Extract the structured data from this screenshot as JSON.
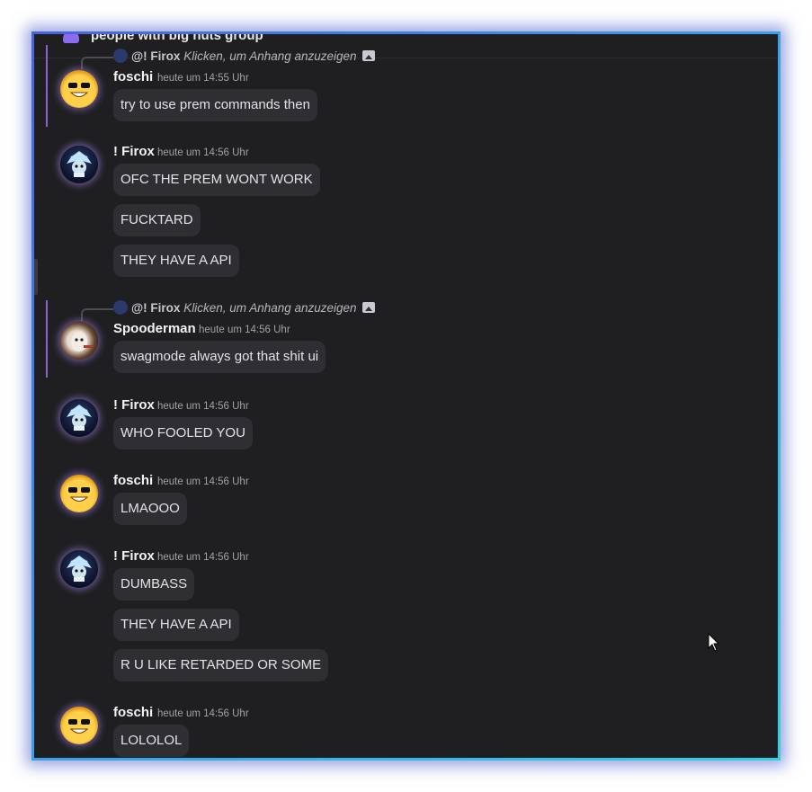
{
  "channel": {
    "title": "people with big nuts group"
  },
  "messages": [
    {
      "author": "foschi",
      "time": "heute um 14:55 Uhr",
      "avatar": "foschi-avatar",
      "reply": {
        "mention": "@! Firox",
        "hint": "Klicken, um Anhang anzuzeigen"
      },
      "lines": [
        "try to use prem commands then"
      ]
    },
    {
      "author": "! Firox",
      "time": "heute um 14:56 Uhr",
      "avatar": "firox-avatar",
      "lines": [
        "OFC THE PREM WONT WORK",
        "FUCKTARD",
        "THEY HAVE A API"
      ]
    },
    {
      "author": "Spooderman",
      "time": "heute um 14:56 Uhr",
      "avatar": "spooderman-avatar",
      "reply": {
        "mention": "@! Firox",
        "hint": "Klicken, um Anhang anzuzeigen"
      },
      "lines": [
        "swagmode always got that shit ui"
      ]
    },
    {
      "author": "! Firox",
      "time": "heute um 14:56 Uhr",
      "avatar": "firox-avatar",
      "lines": [
        "WHO FOOLED YOU"
      ]
    },
    {
      "author": "foschi",
      "time": "heute um 14:56 Uhr",
      "avatar": "foschi-avatar",
      "lines": [
        "LMAOOO"
      ]
    },
    {
      "author": "! Firox",
      "time": "heute um 14:56 Uhr",
      "avatar": "firox-avatar",
      "lines": [
        "DUMBASS",
        "THEY HAVE A API",
        "R U LIKE RETARDED OR SOME"
      ]
    },
    {
      "author": "foschi",
      "time": "heute um 14:56 Uhr",
      "avatar": "foschi-avatar",
      "lines": [
        "LOLOLOL"
      ]
    }
  ],
  "colors": {
    "background": "#1f1f21",
    "bubble": "#2f2f33",
    "mention_bar": "#8f5fd1",
    "window_border_start": "#4b63d9",
    "window_border_end": "#2ed2e6"
  }
}
